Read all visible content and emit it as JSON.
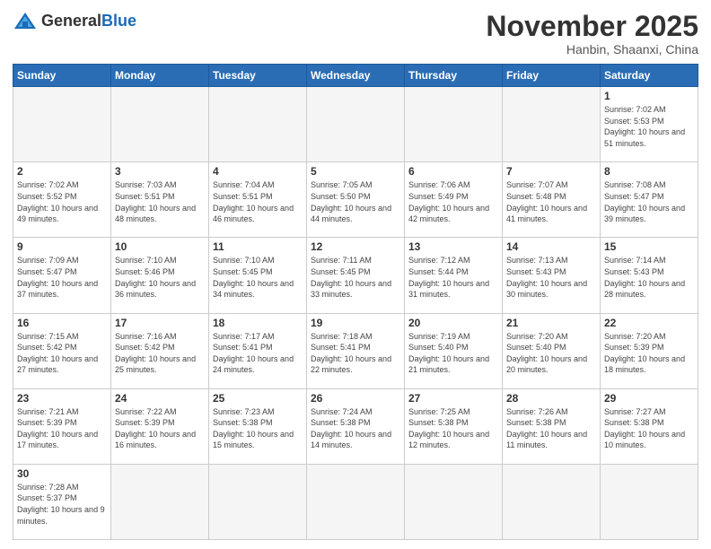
{
  "header": {
    "logo_general": "General",
    "logo_blue": "Blue",
    "month_title": "November 2025",
    "location": "Hanbin, Shaanxi, China"
  },
  "weekdays": [
    "Sunday",
    "Monday",
    "Tuesday",
    "Wednesday",
    "Thursday",
    "Friday",
    "Saturday"
  ],
  "days": {
    "d1": {
      "n": "1",
      "sunrise": "7:02 AM",
      "sunset": "5:53 PM",
      "daylight": "10 hours and 51 minutes."
    },
    "d2": {
      "n": "2",
      "sunrise": "7:02 AM",
      "sunset": "5:52 PM",
      "daylight": "10 hours and 49 minutes."
    },
    "d3": {
      "n": "3",
      "sunrise": "7:03 AM",
      "sunset": "5:51 PM",
      "daylight": "10 hours and 48 minutes."
    },
    "d4": {
      "n": "4",
      "sunrise": "7:04 AM",
      "sunset": "5:51 PM",
      "daylight": "10 hours and 46 minutes."
    },
    "d5": {
      "n": "5",
      "sunrise": "7:05 AM",
      "sunset": "5:50 PM",
      "daylight": "10 hours and 44 minutes."
    },
    "d6": {
      "n": "6",
      "sunrise": "7:06 AM",
      "sunset": "5:49 PM",
      "daylight": "10 hours and 42 minutes."
    },
    "d7": {
      "n": "7",
      "sunrise": "7:07 AM",
      "sunset": "5:48 PM",
      "daylight": "10 hours and 41 minutes."
    },
    "d8": {
      "n": "8",
      "sunrise": "7:08 AM",
      "sunset": "5:47 PM",
      "daylight": "10 hours and 39 minutes."
    },
    "d9": {
      "n": "9",
      "sunrise": "7:09 AM",
      "sunset": "5:47 PM",
      "daylight": "10 hours and 37 minutes."
    },
    "d10": {
      "n": "10",
      "sunrise": "7:10 AM",
      "sunset": "5:46 PM",
      "daylight": "10 hours and 36 minutes."
    },
    "d11": {
      "n": "11",
      "sunrise": "7:10 AM",
      "sunset": "5:45 PM",
      "daylight": "10 hours and 34 minutes."
    },
    "d12": {
      "n": "12",
      "sunrise": "7:11 AM",
      "sunset": "5:45 PM",
      "daylight": "10 hours and 33 minutes."
    },
    "d13": {
      "n": "13",
      "sunrise": "7:12 AM",
      "sunset": "5:44 PM",
      "daylight": "10 hours and 31 minutes."
    },
    "d14": {
      "n": "14",
      "sunrise": "7:13 AM",
      "sunset": "5:43 PM",
      "daylight": "10 hours and 30 minutes."
    },
    "d15": {
      "n": "15",
      "sunrise": "7:14 AM",
      "sunset": "5:43 PM",
      "daylight": "10 hours and 28 minutes."
    },
    "d16": {
      "n": "16",
      "sunrise": "7:15 AM",
      "sunset": "5:42 PM",
      "daylight": "10 hours and 27 minutes."
    },
    "d17": {
      "n": "17",
      "sunrise": "7:16 AM",
      "sunset": "5:42 PM",
      "daylight": "10 hours and 25 minutes."
    },
    "d18": {
      "n": "18",
      "sunrise": "7:17 AM",
      "sunset": "5:41 PM",
      "daylight": "10 hours and 24 minutes."
    },
    "d19": {
      "n": "19",
      "sunrise": "7:18 AM",
      "sunset": "5:41 PM",
      "daylight": "10 hours and 22 minutes."
    },
    "d20": {
      "n": "20",
      "sunrise": "7:19 AM",
      "sunset": "5:40 PM",
      "daylight": "10 hours and 21 minutes."
    },
    "d21": {
      "n": "21",
      "sunrise": "7:20 AM",
      "sunset": "5:40 PM",
      "daylight": "10 hours and 20 minutes."
    },
    "d22": {
      "n": "22",
      "sunrise": "7:20 AM",
      "sunset": "5:39 PM",
      "daylight": "10 hours and 18 minutes."
    },
    "d23": {
      "n": "23",
      "sunrise": "7:21 AM",
      "sunset": "5:39 PM",
      "daylight": "10 hours and 17 minutes."
    },
    "d24": {
      "n": "24",
      "sunrise": "7:22 AM",
      "sunset": "5:39 PM",
      "daylight": "10 hours and 16 minutes."
    },
    "d25": {
      "n": "25",
      "sunrise": "7:23 AM",
      "sunset": "5:38 PM",
      "daylight": "10 hours and 15 minutes."
    },
    "d26": {
      "n": "26",
      "sunrise": "7:24 AM",
      "sunset": "5:38 PM",
      "daylight": "10 hours and 14 minutes."
    },
    "d27": {
      "n": "27",
      "sunrise": "7:25 AM",
      "sunset": "5:38 PM",
      "daylight": "10 hours and 12 minutes."
    },
    "d28": {
      "n": "28",
      "sunrise": "7:26 AM",
      "sunset": "5:38 PM",
      "daylight": "10 hours and 11 minutes."
    },
    "d29": {
      "n": "29",
      "sunrise": "7:27 AM",
      "sunset": "5:38 PM",
      "daylight": "10 hours and 10 minutes."
    },
    "d30": {
      "n": "30",
      "sunrise": "7:28 AM",
      "sunset": "5:37 PM",
      "daylight": "10 hours and 9 minutes."
    }
  }
}
